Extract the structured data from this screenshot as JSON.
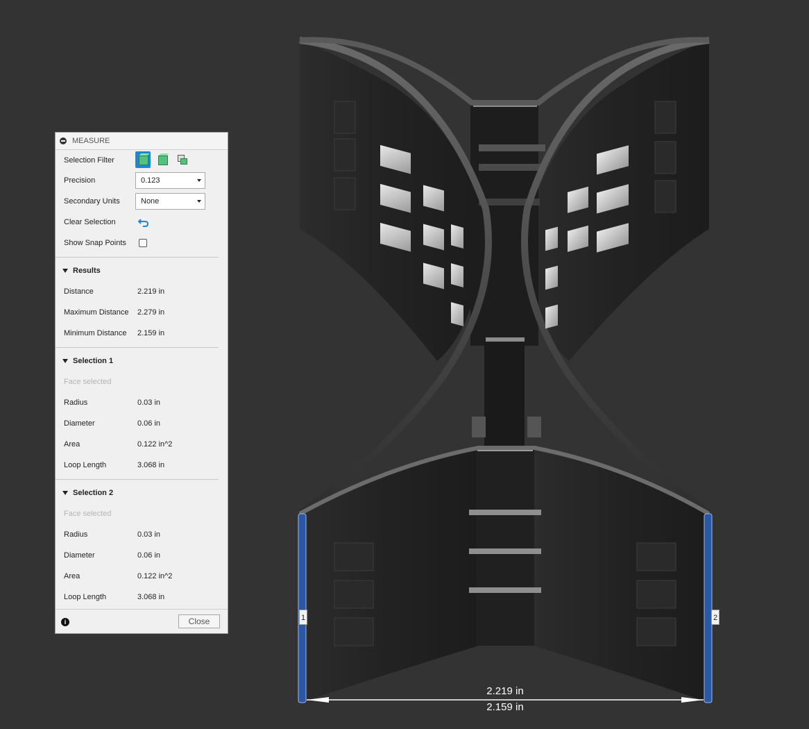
{
  "panel": {
    "title": "MEASURE",
    "selection_filter_label": "Selection Filter",
    "precision_label": "Precision",
    "precision_value": "0.123",
    "secondary_units_label": "Secondary Units",
    "secondary_units_value": "None",
    "clear_selection_label": "Clear Selection",
    "show_snap_points_label": "Show Snap Points",
    "results": {
      "title": "Results",
      "rows": [
        {
          "label": "Distance",
          "value": "2.219 in"
        },
        {
          "label": "Maximum Distance",
          "value": "2.279 in"
        },
        {
          "label": "Minimum Distance",
          "value": "2.159 in"
        }
      ]
    },
    "selection1": {
      "title": "Selection 1",
      "hint": "Face selected",
      "rows": [
        {
          "label": "Radius",
          "value": "0.03 in"
        },
        {
          "label": "Diameter",
          "value": "0.06 in"
        },
        {
          "label": "Area",
          "value": "0.122 in^2"
        },
        {
          "label": "Loop Length",
          "value": "3.068 in"
        }
      ]
    },
    "selection2": {
      "title": "Selection 2",
      "hint": "Face selected",
      "rows": [
        {
          "label": "Radius",
          "value": "0.03 in"
        },
        {
          "label": "Diameter",
          "value": "0.06 in"
        },
        {
          "label": "Area",
          "value": "0.122 in^2"
        },
        {
          "label": "Loop Length",
          "value": "3.068 in"
        }
      ]
    },
    "close_label": "Close",
    "info_glyph": "i"
  },
  "viewport": {
    "marker1": "1",
    "marker2": "2",
    "dimension_top": "2.219 in",
    "dimension_bottom": "2.159 in"
  },
  "colors": {
    "background": "#333333",
    "selection_face": "#2a58a6",
    "accent": "#1e87d1"
  },
  "icons": {
    "collapse": "collapse-icon",
    "filter_body": "body-filter-icon",
    "filter_face": "face-filter-icon",
    "filter_edge": "edge-filter-icon",
    "clear": "undo-icon",
    "info": "info-icon"
  }
}
